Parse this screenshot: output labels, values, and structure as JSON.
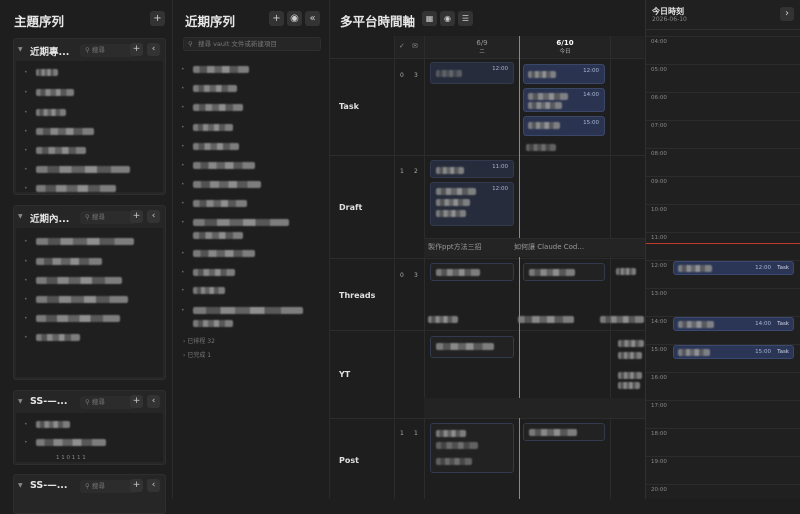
{
  "left_panel": {
    "title": "主題序列",
    "add_button": "+",
    "sections": [
      {
        "title": "近期專...",
        "search_placeholder": "搜尋",
        "add": "+",
        "collapse": "‹"
      },
      {
        "title": "近期內...",
        "search_placeholder": "搜尋",
        "add": "+",
        "collapse": "‹"
      },
      {
        "title": "SS-—...",
        "search_placeholder": "搜尋",
        "add": "+",
        "collapse": "‹"
      },
      {
        "title": "SS-—...",
        "search_placeholder": "搜尋",
        "add": "+",
        "collapse": "‹"
      }
    ],
    "partial_text": "1 1 0 1 1 1"
  },
  "middle_panel": {
    "title": "近期序列",
    "add_button": "+",
    "eye_button": "◉",
    "collapse_button": "«",
    "search_placeholder": "搜尋 vault 文件或新建項目",
    "groups": [
      {
        "label": "已排程",
        "count": "32"
      },
      {
        "label": "已完成",
        "count": "1"
      }
    ]
  },
  "timeline": {
    "title": "多平台時間軸",
    "day_prev": {
      "date": "6/9",
      "weekday": "二"
    },
    "day_today": {
      "date": "6/10",
      "weekday": "今日"
    },
    "rows": [
      {
        "name": "Task",
        "a": "0",
        "b": "3"
      },
      {
        "name": "Draft",
        "a": "1",
        "b": "2"
      },
      {
        "name": "Threads",
        "a": "0",
        "b": "3"
      },
      {
        "name": "YT",
        "a": "",
        "b": ""
      },
      {
        "name": "Post",
        "a": "1",
        "b": "1"
      }
    ],
    "task_times_prev": [
      "12:00"
    ],
    "task_times_today": [
      "12:00",
      "14:00",
      "15:00"
    ],
    "draft_times_prev": [
      "11:00",
      "12:00"
    ],
    "draft_titles": [
      "製作ppt方法三招",
      "如何讓 Claude Cod..."
    ],
    "accent_color": "#3e6fd8"
  },
  "today_panel": {
    "title": "今日時刻",
    "date": "2026-06-10",
    "next_button": "›",
    "hours": [
      "04:00",
      "05:00",
      "06:00",
      "07:00",
      "08:00",
      "09:00",
      "10:00",
      "11:00",
      "12:00",
      "13:00",
      "14:00",
      "15:00",
      "16:00",
      "17:00",
      "18:00",
      "19:00",
      "20:00"
    ],
    "events": [
      {
        "time": "12:00",
        "kind": "Task"
      },
      {
        "time": "14:00",
        "kind": "Task"
      },
      {
        "time": "15:00",
        "kind": "Task"
      }
    ],
    "now_line_color": "#c0392b"
  }
}
